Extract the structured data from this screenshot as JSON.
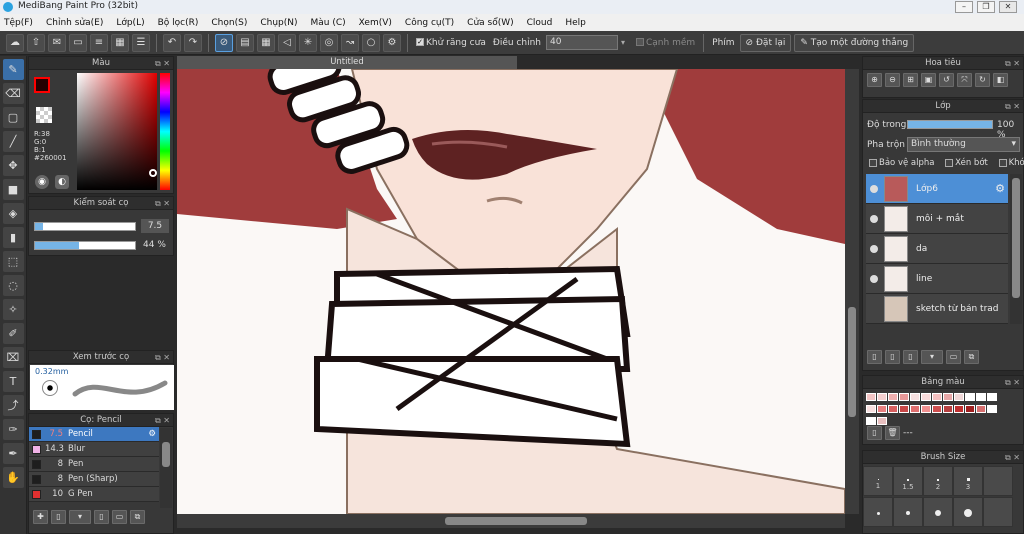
{
  "title": "MediBang Paint Pro (32bit)",
  "window_buttons": [
    "–",
    "❐",
    "✕"
  ],
  "menu": [
    "Tệp(F)",
    "Chỉnh sửa(E)",
    "Lớp(L)",
    "Bộ lọc(R)",
    "Chọn(S)",
    "Chụp(N)",
    "Màu (C)",
    "Xem(V)",
    "Công cụ(T)",
    "Cửa sổ(W)",
    "Cloud",
    "Help"
  ],
  "toolbar": {
    "antialias_label": "Khử răng cưa",
    "adjust_label": "Điều chỉnh",
    "adjust_value": "40",
    "strong_edge_label": "Cạnh mềm",
    "key_label": "Phím",
    "reset_label": "Đặt lại",
    "straight_label": "Tạo một đường thẳng"
  },
  "color_panel": {
    "title": "Màu",
    "r": "R:38",
    "g": "G:0",
    "b": "B:1",
    "hex": "#260001",
    "primary": "#260001"
  },
  "brush_control": {
    "title": "Kiểm soát cọ",
    "size": "7.5",
    "opacity": "44 %",
    "size_fraction": 0.08,
    "opacity_fraction": 0.44
  },
  "preview": {
    "title": "Xem trước cọ",
    "size": "0.32mm"
  },
  "brush_list": {
    "title": "Cọ: Pencil",
    "items": [
      {
        "size": "7.5",
        "name": "Pencil",
        "color": "#1e1e1e"
      },
      {
        "size": "14.3",
        "name": "Blur",
        "color": "#f2b3e8"
      },
      {
        "size": "8",
        "name": "Pen",
        "color": "#1e1e1e"
      },
      {
        "size": "8",
        "name": "Pen (Sharp)",
        "color": "#1e1e1e"
      },
      {
        "size": "10",
        "name": "G Pen",
        "color": "#e03030"
      }
    ]
  },
  "document": {
    "tab": "Untitled"
  },
  "navigator": {
    "title": "Hoa tiêu"
  },
  "layer_panel": {
    "title": "Lớp",
    "opacity_label": "Độ trong",
    "opacity_value": "100 %",
    "opacity_fraction": 1.0,
    "blend_label": "Pha trộn",
    "blend_value": "Bình thường",
    "protect_alpha": "Bảo vệ alpha",
    "clipping": "Xén bớt",
    "lock": "Khóa",
    "layers": [
      "Lớp6",
      "môi + mắt",
      "da",
      "line",
      "sketch từ bản trad"
    ]
  },
  "palette_panel": {
    "title": "Bảng màu",
    "extra": "---"
  },
  "brush_size_panel": {
    "title": "Brush Size",
    "sizes": [
      "1",
      "1.5",
      "2",
      "3"
    ]
  }
}
